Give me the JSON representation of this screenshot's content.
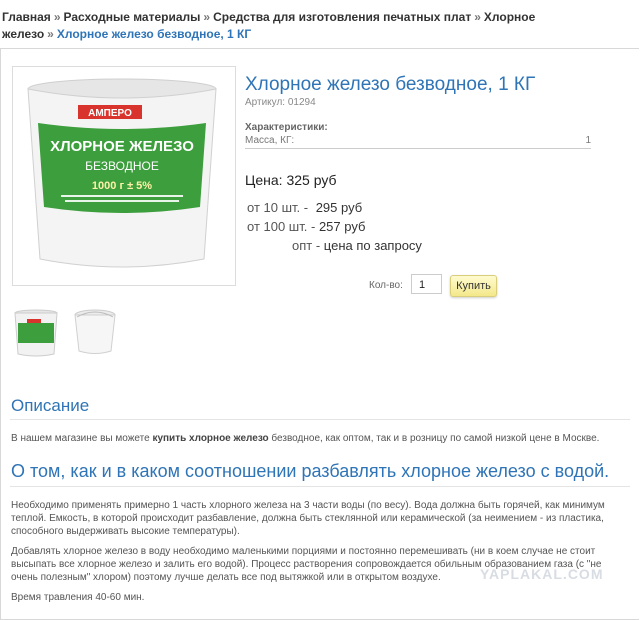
{
  "breadcrumb": {
    "items": [
      "Главная",
      "Расходные материалы",
      "Средства для изготовления печатных плат",
      "Хлорное железо"
    ],
    "current": "Хлорное железо безводное, 1 КГ",
    "separator": "»"
  },
  "product": {
    "title": "Хлорное железо безводное, 1 КГ",
    "sku": "Артикул: 01294",
    "characteristics_label": "Характеристики:",
    "mass_label": "Масса, КГ:",
    "mass_value": "1",
    "price": "Цена: 325 руб",
    "tiers": [
      {
        "label": "от 10 шт. -",
        "value": "295 руб"
      },
      {
        "label": "от 100 шт. -",
        "value": "257 руб"
      },
      {
        "label": "опт -",
        "value": "цена по запросу"
      }
    ],
    "qty_label": "Кол-во:",
    "qty_value": "1",
    "buy_label": "Купить"
  },
  "image": {
    "brand": "АМПЕРО",
    "name_line1": "ХЛОРНОЕ ЖЕЛЕЗО",
    "name_line2": "БЕЗВОДНОЕ",
    "weight": "1000 г ± 5%"
  },
  "description": {
    "heading": "Описание",
    "text_before": "В нашем магазине вы можете ",
    "text_bold": "купить хлорное железо",
    "text_after": " безводное, как оптом, так и в розницу по самой низкой цене в Москве."
  },
  "howto": {
    "heading": "О том, как и в каком соотношении разбавлять хлорное железо с водой.",
    "p1": "Необходимо применять примерно 1 часть хлорного железа на 3 части воды (по весу). Вода должна быть горячей, как минимум теплой. Емкость, в которой происходит разбавление, должна быть стеклянной или керамической (за неимением - из пластика, способного выдерживать высокие температуры).",
    "p2": "Добавлять хлорное железо в воду необходимо маленькими порциями и постоянно перемешивать (ни в коем случае не стоит высыпать все хлорное железо и залить его водой). Процесс растворения сопровождается обильным образованием газа (с \"не очень полезным\" хлором) поэтому лучше делать все под вытяжкой или в открытом воздухе.",
    "p3": "Время травления 40-60 мин."
  },
  "watermark": "YAPLAKAL.COM",
  "colors": {
    "accent": "#2e74b6",
    "label_green": "#3c9e3c",
    "bucket": "#f2f2f2"
  }
}
